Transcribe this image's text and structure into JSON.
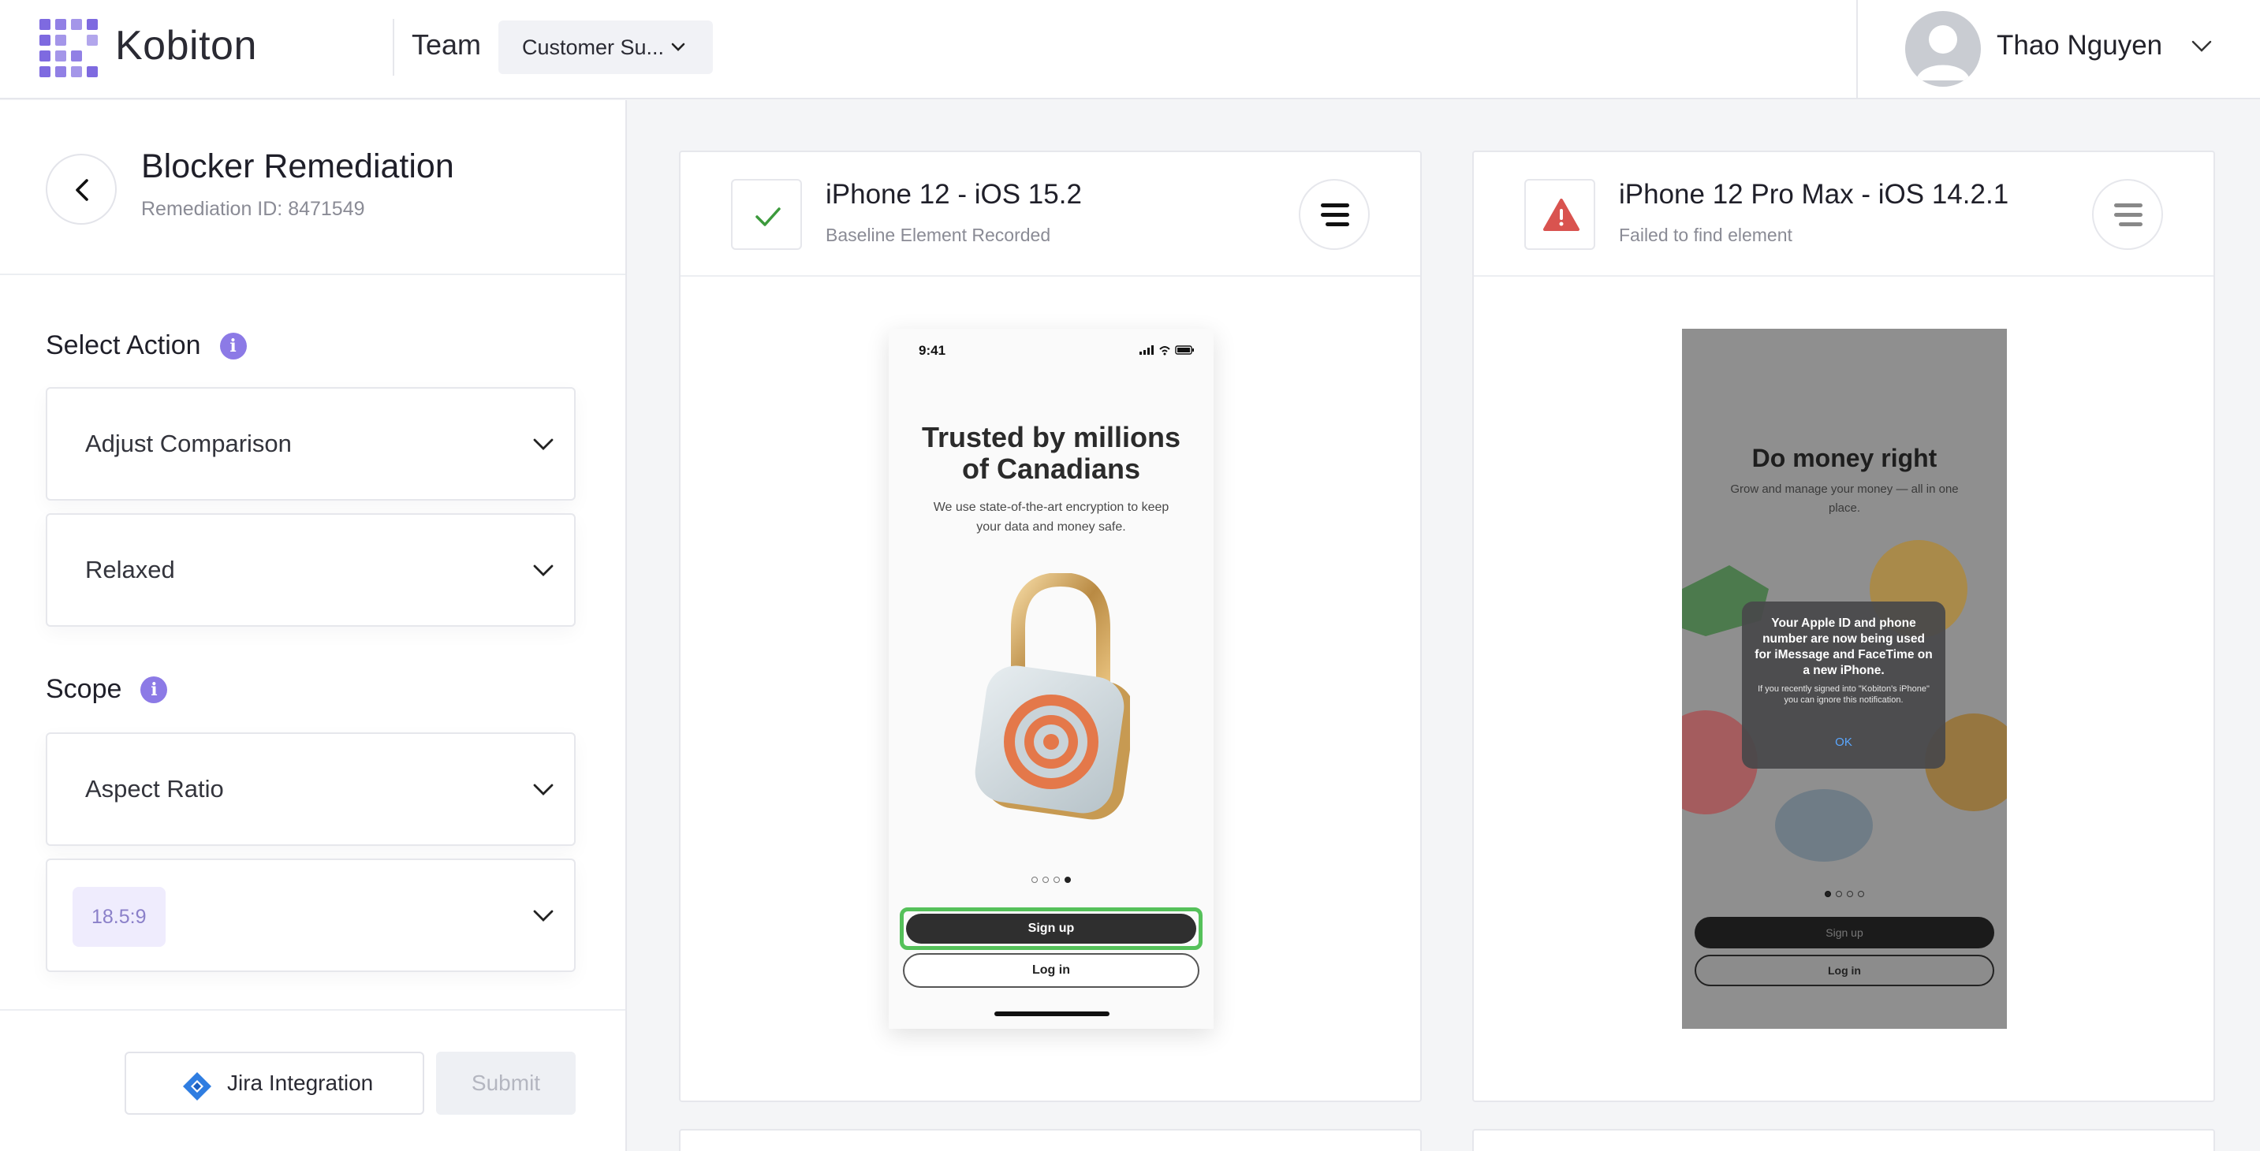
{
  "header": {
    "logo_text": "Kobiton",
    "team_label": "Team",
    "team_selected": "Customer Su...",
    "user_name": "Thao Nguyen"
  },
  "sidebar": {
    "title": "Blocker Remediation",
    "remediation_id": "Remediation ID: 8471549",
    "select_action_label": "Select Action",
    "action_dropdown": "Adjust Comparison",
    "level_dropdown": "Relaxed",
    "scope_label": "Scope",
    "scope_dropdown": "Aspect Ratio",
    "ratio_chip": "18.5:9",
    "jira_button": "Jira Integration",
    "submit_button": "Submit"
  },
  "cards": [
    {
      "title": "iPhone 12 - iOS 15.2",
      "subtitle": "Baseline Element Recorded",
      "status": "success",
      "screen": {
        "time": "9:41",
        "headline_line1": "Trusted by millions",
        "headline_line2": "of Canadians",
        "body": "We use state-of-the-art encryption to keep your data and money safe.",
        "primary_button": "Sign up",
        "secondary_button": "Log in"
      }
    },
    {
      "title": "iPhone 12 Pro Max - iOS 14.2.1",
      "subtitle": "Failed to find element",
      "status": "error",
      "screen": {
        "headline": "Do money right",
        "body": "Grow and manage your money — all in one place.",
        "alert_title": "Your Apple ID and phone number are now being used for iMessage and FaceTime on a new iPhone.",
        "alert_body": "If you recently signed into \"Kobiton's iPhone\" you can ignore this notification.",
        "alert_ok": "OK",
        "primary_button": "Sign up",
        "secondary_button": "Log in"
      }
    }
  ],
  "colors": {
    "accent": "#8c7ae6",
    "success": "#3c9a3c",
    "error": "#d9534f",
    "highlight": "#55c15a"
  }
}
